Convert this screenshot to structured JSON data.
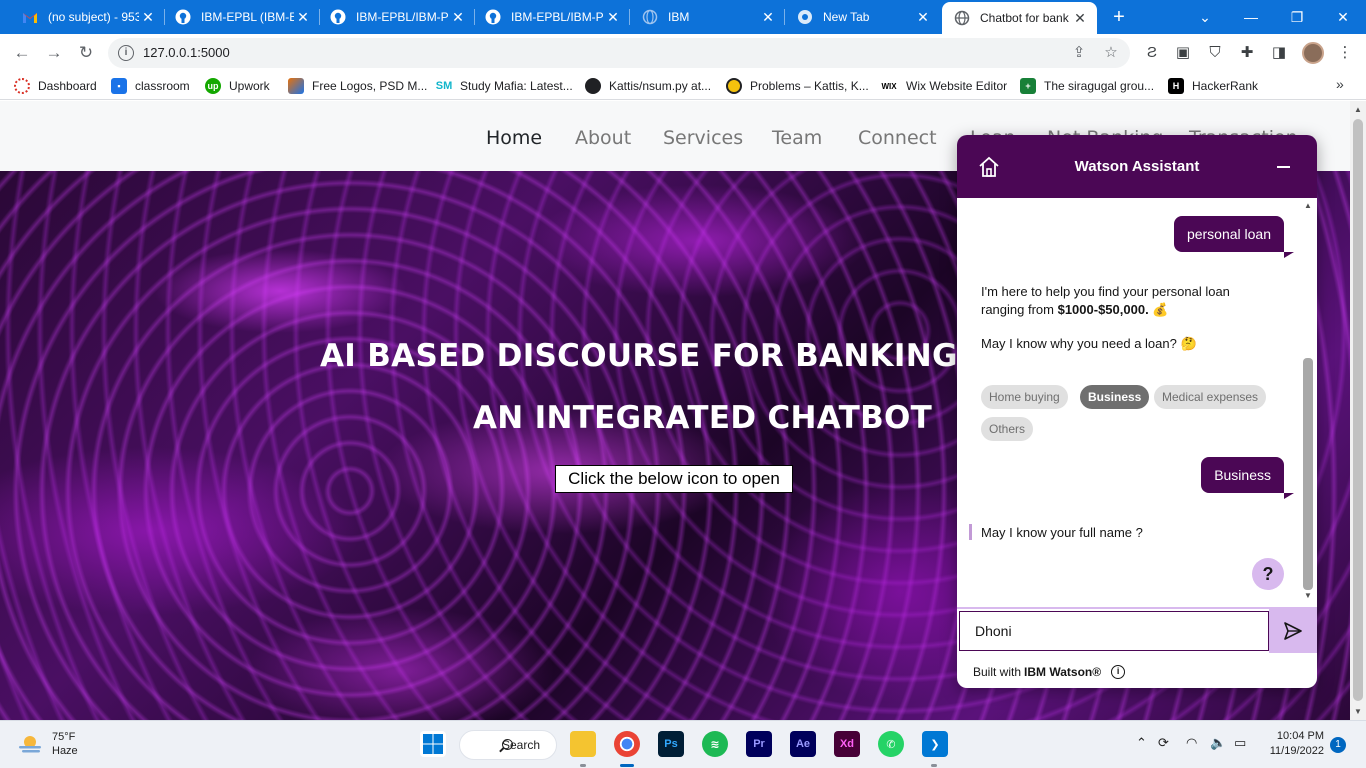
{
  "browser": {
    "tabs": [
      {
        "title": "(no subject) - 953",
        "favicon": "gmail-icon",
        "active": false
      },
      {
        "title": "IBM-EPBL (IBM-E",
        "favicon": "github-icon",
        "active": false
      },
      {
        "title": "IBM-EPBL/IBM-P",
        "favicon": "github-icon",
        "active": false
      },
      {
        "title": "IBM-EPBL/IBM-P",
        "favicon": "github-icon",
        "active": false
      },
      {
        "title": "IBM",
        "favicon": "globe-icon",
        "active": false
      },
      {
        "title": "New Tab",
        "favicon": "chrome-icon",
        "active": false
      },
      {
        "title": "Chatbot for bank",
        "favicon": "globe-icon",
        "active": true
      }
    ],
    "url": "127.0.0.1:5000",
    "bookmarks": [
      {
        "label": "Dashboard",
        "icon": "dashboard-icon",
        "color": "#d93025"
      },
      {
        "label": "classroom",
        "icon": "classroom-icon",
        "color": "#1a73e8"
      },
      {
        "label": "Upwork",
        "icon": "upwork-icon",
        "color": "#14a800"
      },
      {
        "label": "Free Logos, PSD M...",
        "icon": "freelogos-icon",
        "color": "#e8710a"
      },
      {
        "label": "Study Mafia: Latest...",
        "icon": "studymafia-icon",
        "color": "#12b5cb"
      },
      {
        "label": "Kattis/nsum.py at...",
        "icon": "github-icon",
        "color": "#202124"
      },
      {
        "label": "Problems – Kattis, K...",
        "icon": "kattis-icon",
        "color": "#202124"
      },
      {
        "label": "Wix Website Editor",
        "icon": "wix-icon",
        "color": "#000000"
      },
      {
        "label": "The siragugal grou...",
        "icon": "sheets-icon",
        "color": "#188038"
      },
      {
        "label": "HackerRank",
        "icon": "hackerrank-icon",
        "color": "#000000"
      }
    ],
    "bookmarks_more": "»"
  },
  "site": {
    "nav": [
      "Home",
      "About",
      "Services",
      "Team",
      "Connect",
      "Loan",
      "Net Banking",
      "Transaction"
    ],
    "hero_title": "AI BASED DISCOURSE FOR BANKING INDUSTRY",
    "hero_subtitle": "AN INTEGRATED CHATBOT",
    "hero_button": "Click the below icon to open"
  },
  "chat": {
    "title": "Watson Assistant",
    "messages": {
      "user1": "personal loan",
      "bot1_prefix": "I'm here to help you find your personal loan ranging from ",
      "bot1_amount": "$1000-$50,000.",
      "bot1_emoji": "💰",
      "bot2": "May I know why you need a loan?",
      "bot2_emoji": "🤔",
      "options": [
        "Home buying",
        "Business",
        "Medical expenses",
        "Others"
      ],
      "selected_option": "Business",
      "user2": "Business",
      "bot3": "May I know your full name ?"
    },
    "help_label": "?",
    "input_value": "Dhoni",
    "footer_prefix": "Built with",
    "footer_brand": "IBM Watson®",
    "accent": "#4b0755",
    "accent_light": "#d8b9ee"
  },
  "taskbar": {
    "temperature": "75°F",
    "condition": "Haze",
    "search_label": "Search",
    "apps": [
      "file-explorer-icon",
      "chrome-icon",
      "photoshop-icon",
      "spotify-icon",
      "premiere-icon",
      "after-effects-icon",
      "xd-icon",
      "whatsapp-icon",
      "vscode-icon"
    ],
    "time": "10:04 PM",
    "date": "11/19/2022",
    "notification_count": "1"
  }
}
